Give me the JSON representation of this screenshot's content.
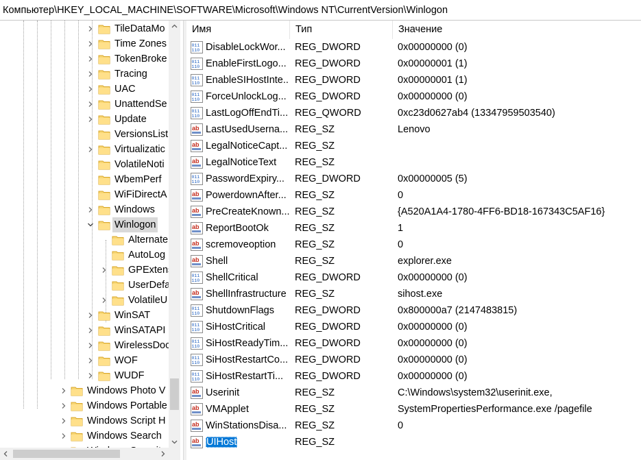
{
  "address": "Компьютер\\HKEY_LOCAL_MACHINE\\SOFTWARE\\Microsoft\\Windows NT\\CurrentVersion\\Winlogon",
  "tree": [
    {
      "label": "TileDataMo",
      "level": 1,
      "expander": "right",
      "selected": false
    },
    {
      "label": "Time Zones",
      "level": 1,
      "expander": "right",
      "selected": false
    },
    {
      "label": "TokenBroke",
      "level": 1,
      "expander": "right",
      "selected": false
    },
    {
      "label": "Tracing",
      "level": 1,
      "expander": "right",
      "selected": false
    },
    {
      "label": "UAC",
      "level": 1,
      "expander": "right",
      "selected": false
    },
    {
      "label": "UnattendSe",
      "level": 1,
      "expander": "right",
      "selected": false
    },
    {
      "label": "Update",
      "level": 1,
      "expander": "right",
      "selected": false
    },
    {
      "label": "VersionsList",
      "level": 1,
      "expander": "none",
      "selected": false
    },
    {
      "label": "Virtualizatic",
      "level": 1,
      "expander": "right",
      "selected": false
    },
    {
      "label": "VolatileNoti",
      "level": 1,
      "expander": "none",
      "selected": false
    },
    {
      "label": "WbemPerf",
      "level": 1,
      "expander": "none",
      "selected": false
    },
    {
      "label": "WiFiDirectA",
      "level": 1,
      "expander": "none",
      "selected": false
    },
    {
      "label": "Windows",
      "level": 1,
      "expander": "right",
      "selected": false
    },
    {
      "label": "Winlogon",
      "level": 1,
      "expander": "down",
      "selected": true
    },
    {
      "label": "Alternate",
      "level": 2,
      "expander": "none",
      "selected": false
    },
    {
      "label": "AutoLog",
      "level": 2,
      "expander": "none",
      "selected": false
    },
    {
      "label": "GPExtens",
      "level": 2,
      "expander": "right",
      "selected": false
    },
    {
      "label": "UserDefa",
      "level": 2,
      "expander": "none",
      "selected": false
    },
    {
      "label": "VolatileU",
      "level": 2,
      "expander": "right",
      "selected": false
    },
    {
      "label": "WinSAT",
      "level": 1,
      "expander": "right",
      "selected": false
    },
    {
      "label": "WinSATAPI",
      "level": 1,
      "expander": "right",
      "selected": false
    },
    {
      "label": "WirelessDoc",
      "level": 1,
      "expander": "right",
      "selected": false
    },
    {
      "label": "WOF",
      "level": 1,
      "expander": "right",
      "selected": false
    },
    {
      "label": "WUDF",
      "level": 1,
      "expander": "right",
      "selected": false
    },
    {
      "label": "Windows Photo V",
      "level": 0,
      "expander": "right",
      "selected": false
    },
    {
      "label": "Windows Portable",
      "level": 0,
      "expander": "right",
      "selected": false
    },
    {
      "label": "Windows Script H",
      "level": 0,
      "expander": "right",
      "selected": false
    },
    {
      "label": "Windows Search",
      "level": 0,
      "expander": "right",
      "selected": false
    },
    {
      "label": "Windows Security",
      "level": 0,
      "expander": "right",
      "selected": false
    }
  ],
  "columns": {
    "name": "Имя",
    "type": "Тип",
    "data": "Значение"
  },
  "values": [
    {
      "name": "DisableLockWor...",
      "type": "REG_DWORD",
      "data": "0x00000000 (0)",
      "icon": "binary-value-icon"
    },
    {
      "name": "EnableFirstLogo...",
      "type": "REG_DWORD",
      "data": "0x00000001 (1)",
      "icon": "binary-value-icon"
    },
    {
      "name": "EnableSIHostInte...",
      "type": "REG_DWORD",
      "data": "0x00000001 (1)",
      "icon": "binary-value-icon"
    },
    {
      "name": "ForceUnlockLog...",
      "type": "REG_DWORD",
      "data": "0x00000000 (0)",
      "icon": "binary-value-icon"
    },
    {
      "name": "LastLogOffEndTi...",
      "type": "REG_QWORD",
      "data": "0xc23d0627ab4 (13347959503540)",
      "icon": "binary-value-icon"
    },
    {
      "name": "LastUsedUserna...",
      "type": "REG_SZ",
      "data": "Lenovo",
      "icon": "string-value-icon"
    },
    {
      "name": "LegalNoticeCapt...",
      "type": "REG_SZ",
      "data": "",
      "icon": "string-value-icon"
    },
    {
      "name": "LegalNoticeText",
      "type": "REG_SZ",
      "data": "",
      "icon": "string-value-icon"
    },
    {
      "name": "PasswordExpiry...",
      "type": "REG_DWORD",
      "data": "0x00000005 (5)",
      "icon": "binary-value-icon"
    },
    {
      "name": "PowerdownAfter...",
      "type": "REG_SZ",
      "data": "0",
      "icon": "string-value-icon"
    },
    {
      "name": "PreCreateKnown...",
      "type": "REG_SZ",
      "data": "{A520A1A4-1780-4FF6-BD18-167343C5AF16}",
      "icon": "string-value-icon"
    },
    {
      "name": "ReportBootOk",
      "type": "REG_SZ",
      "data": "1",
      "icon": "string-value-icon"
    },
    {
      "name": "scremoveoption",
      "type": "REG_SZ",
      "data": "0",
      "icon": "string-value-icon"
    },
    {
      "name": "Shell",
      "type": "REG_SZ",
      "data": "explorer.exe",
      "icon": "string-value-icon"
    },
    {
      "name": "ShellCritical",
      "type": "REG_DWORD",
      "data": "0x00000000 (0)",
      "icon": "binary-value-icon"
    },
    {
      "name": "ShellInfrastructure",
      "type": "REG_SZ",
      "data": "sihost.exe",
      "icon": "string-value-icon"
    },
    {
      "name": "ShutdownFlags",
      "type": "REG_DWORD",
      "data": "0x800000a7 (2147483815)",
      "icon": "binary-value-icon"
    },
    {
      "name": "SiHostCritical",
      "type": "REG_DWORD",
      "data": "0x00000000 (0)",
      "icon": "binary-value-icon"
    },
    {
      "name": "SiHostReadyTim...",
      "type": "REG_DWORD",
      "data": "0x00000000 (0)",
      "icon": "binary-value-icon"
    },
    {
      "name": "SiHostRestartCo...",
      "type": "REG_DWORD",
      "data": "0x00000000 (0)",
      "icon": "binary-value-icon"
    },
    {
      "name": "SiHostRestartTi...",
      "type": "REG_DWORD",
      "data": "0x00000000 (0)",
      "icon": "binary-value-icon"
    },
    {
      "name": "Userinit",
      "type": "REG_SZ",
      "data": "C:\\Windows\\system32\\userinit.exe,",
      "icon": "string-value-icon"
    },
    {
      "name": "VMApplet",
      "type": "REG_SZ",
      "data": "SystemPropertiesPerformance.exe /pagefile",
      "icon": "string-value-icon"
    },
    {
      "name": "WinStationsDisa...",
      "type": "REG_SZ",
      "data": "0",
      "icon": "string-value-icon"
    },
    {
      "name": "UIHost",
      "type": "REG_SZ",
      "data": "",
      "icon": "string-value-icon",
      "selected": true
    }
  ]
}
